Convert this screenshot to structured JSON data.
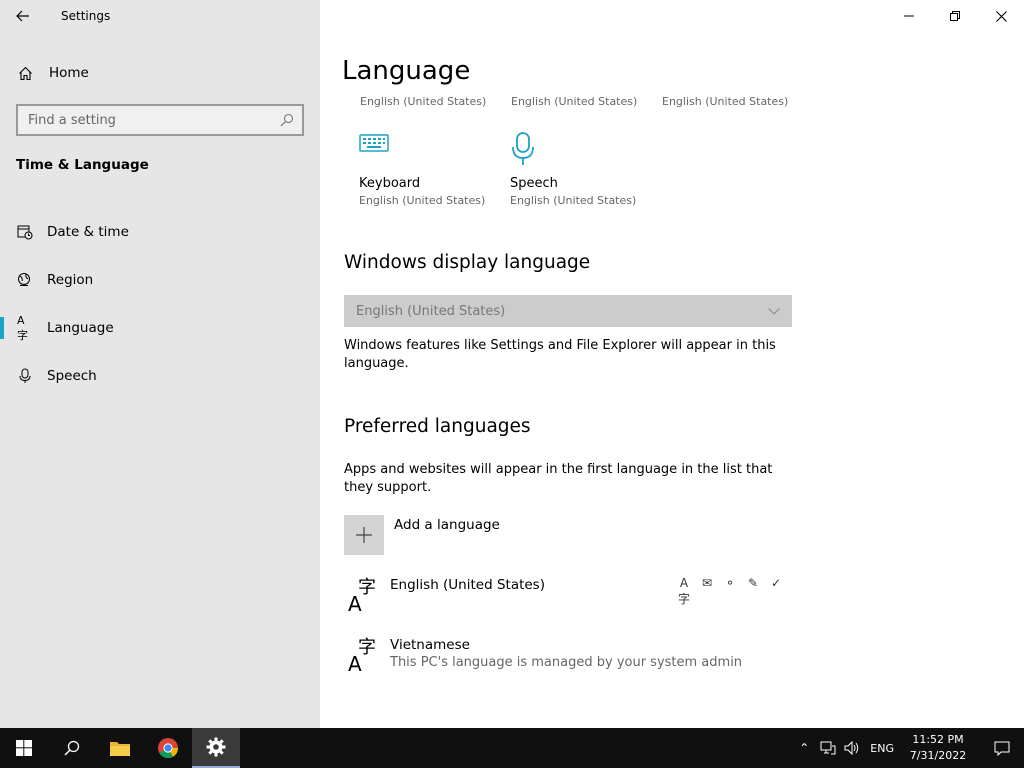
{
  "app": {
    "title": "Settings"
  },
  "sidebar": {
    "home_label": "Home",
    "search_placeholder": "Find a setting",
    "section_title": "Time & Language",
    "items": [
      {
        "label": "Date & time",
        "icon": "calendar-clock-icon"
      },
      {
        "label": "Region",
        "icon": "globe-icon"
      },
      {
        "label": "Language",
        "icon": "language-icon",
        "active": true
      },
      {
        "label": "Speech",
        "icon": "microphone-icon"
      }
    ]
  },
  "main": {
    "title": "Language",
    "top_subtitles": [
      "English (United States)",
      "English (United States)",
      "English (United States)"
    ],
    "tiles": [
      {
        "name": "Keyboard",
        "sub": "English (United States)",
        "icon": "keyboard-icon"
      },
      {
        "name": "Speech",
        "sub": "English (United States)",
        "icon": "microphone-icon"
      }
    ],
    "display_language": {
      "heading": "Windows display language",
      "selected": "English (United States)",
      "description": "Windows features like Settings and File Explorer will appear in this language."
    },
    "preferred": {
      "heading": "Preferred languages",
      "description": "Apps and websites will appear in the first language in the list that they support.",
      "add_label": "Add a language",
      "languages": [
        {
          "name": "English (United States)",
          "sub": ""
        },
        {
          "name": "Vietnamese",
          "sub": "This PC's language is managed by your system admin"
        }
      ]
    }
  },
  "taskbar": {
    "language": "ENG",
    "time": "11:52 PM",
    "date": "7/31/2022"
  },
  "colors": {
    "accent": "#1aa3c4",
    "sidebar_bg": "#e6e6e6",
    "taskbar_bg": "#101010"
  }
}
